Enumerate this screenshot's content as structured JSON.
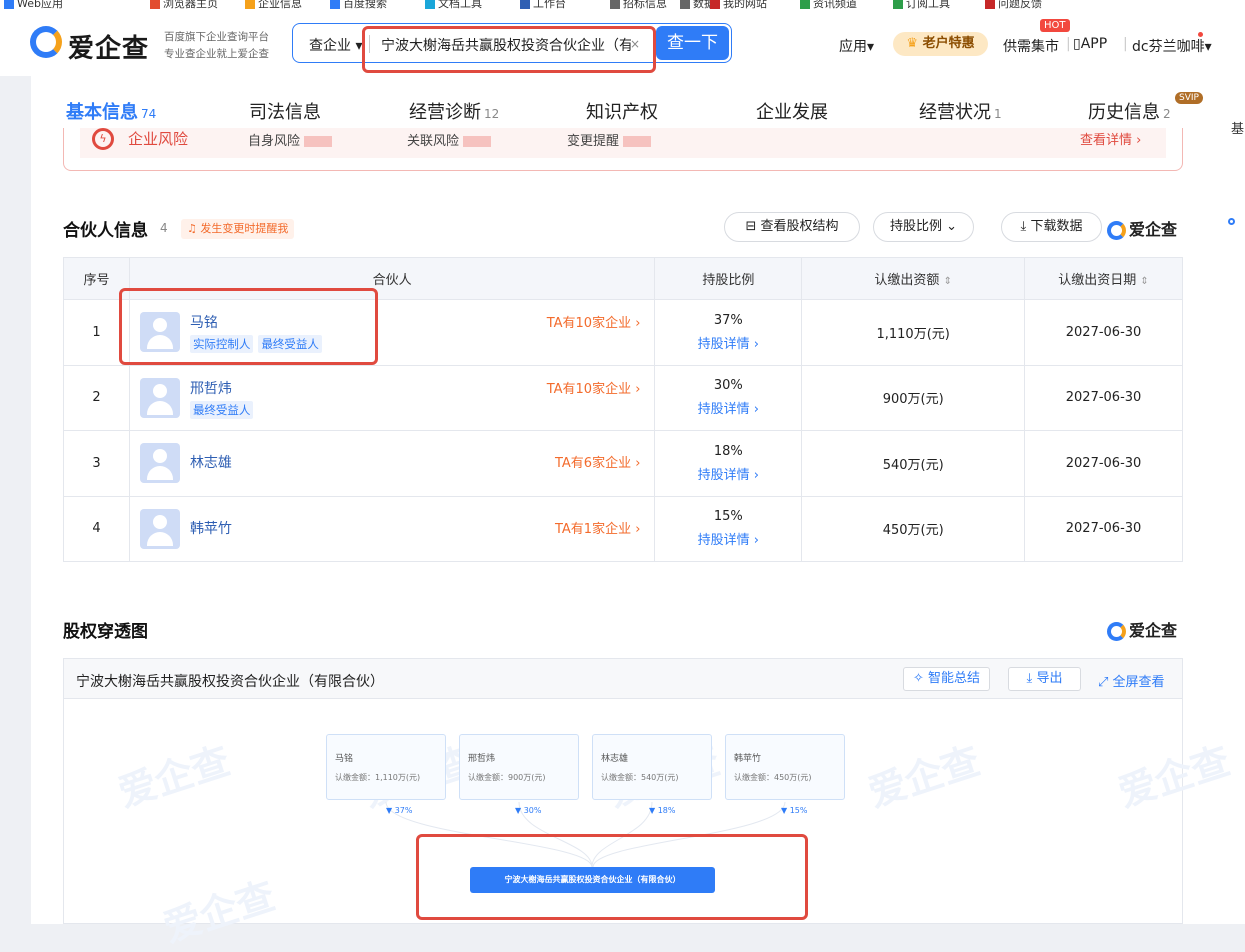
{
  "bookmarks": [
    "Web应用",
    "浏览器主页",
    "企业信息",
    "百度搜索",
    "文档工具",
    "工作台",
    "招标信息",
    "数据",
    "我的网站",
    "资讯频道",
    "订阅工具",
    "问题反馈"
  ],
  "header": {
    "logo_text": "爱企查",
    "tagline1": "百度旗下企业查询平台",
    "tagline2": "专业查企业就上爱企查",
    "search_type": "查企业",
    "search_value": "宁波大榭海岳共赢股权投资合伙企业（有限合伙）",
    "search_button": "查一下",
    "nav": {
      "apps": "应用",
      "vip": "老户特惠",
      "market": "供需集市",
      "hot": "HOT",
      "app": "APP",
      "user": "dc芬兰咖啡"
    }
  },
  "rightrail": {
    "label": "基"
  },
  "tabs": [
    {
      "label": "基本信息",
      "count": "74"
    },
    {
      "label": "司法信息",
      "count": ""
    },
    {
      "label": "经营诊断",
      "count": "12"
    },
    {
      "label": "知识产权",
      "count": ""
    },
    {
      "label": "企业发展",
      "count": ""
    },
    {
      "label": "经营状况",
      "count": "1"
    },
    {
      "label": "历史信息",
      "count": "2"
    }
  ],
  "svip": "SVIP",
  "risk": {
    "icon": "ϟ",
    "title": "企业风险",
    "items": [
      "自身风险",
      "关联风险",
      "变更提醒"
    ],
    "more": "查看详情 ›"
  },
  "partners": {
    "title": "合伙人信息",
    "count": "4",
    "remind": "发生变更时提醒我",
    "btn_structure": "查看股权结构",
    "btn_ratio": "持股比例",
    "btn_download": "下载数据",
    "brand": "爱企查",
    "columns": [
      "序号",
      "合伙人",
      "持股比例",
      "认缴出资额",
      "认缴出资日期"
    ],
    "rows": [
      {
        "no": "1",
        "name": "马铭",
        "tags": [
          "实际控制人",
          "最终受益人"
        ],
        "ta": "TA有10家企业 ›",
        "ratio": "37%",
        "link": "持股详情 ›",
        "amount": "1,110万(元)",
        "date": "2027-06-30"
      },
      {
        "no": "2",
        "name": "邢哲炜",
        "tags": [
          "最终受益人"
        ],
        "ta": "TA有10家企业 ›",
        "ratio": "30%",
        "link": "持股详情 ›",
        "amount": "900万(元)",
        "date": "2027-06-30"
      },
      {
        "no": "3",
        "name": "林志雄",
        "tags": [],
        "ta": "TA有6家企业 ›",
        "ratio": "18%",
        "link": "持股详情 ›",
        "amount": "540万(元)",
        "date": "2027-06-30"
      },
      {
        "no": "4",
        "name": "韩苹竹",
        "tags": [],
        "ta": "TA有1家企业 ›",
        "ratio": "15%",
        "link": "持股详情 ›",
        "amount": "450万(元)",
        "date": "2027-06-30"
      }
    ]
  },
  "equity": {
    "title": "股权穿透图",
    "brand": "爱企查",
    "company": "宁波大榭海岳共赢股权投资合伙企业（有限合伙）",
    "btn_summary": "智能总结",
    "btn_export": "导出",
    "btn_full": "全屏查看",
    "watermark": "爱企查",
    "nodes": [
      {
        "name": "马铭",
        "amount": "认缴金额：1,110万(元)",
        "pct": "37%"
      },
      {
        "name": "邢哲炜",
        "amount": "认缴金额：900万(元)",
        "pct": "30%"
      },
      {
        "name": "林志雄",
        "amount": "认缴金额：540万(元)",
        "pct": "18%"
      },
      {
        "name": "韩苹竹",
        "amount": "认缴金额：450万(元)",
        "pct": "15%"
      }
    ],
    "center": "宁波大榭海岳共赢股权投资合伙企业（有限合伙）"
  },
  "colors": {
    "accent": "#2f7cf7",
    "risk": "#e04a3f",
    "orange": "#f36b2c",
    "highlight": "#e04a3f"
  }
}
